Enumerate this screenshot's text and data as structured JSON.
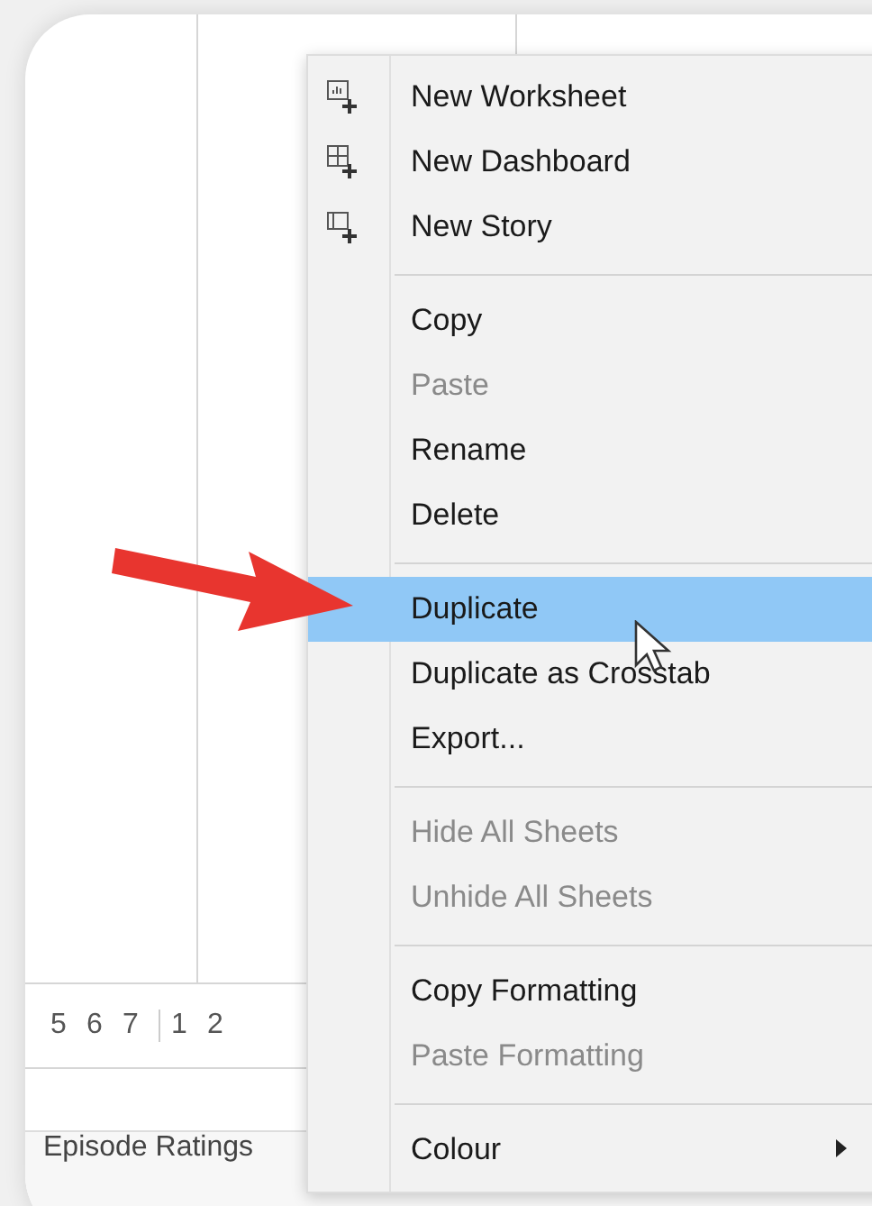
{
  "axis_labels": [
    "5",
    "6",
    "7",
    "1",
    "2"
  ],
  "sheet_tabs": [
    {
      "label": "Episode Ratings"
    }
  ],
  "context_menu": [
    {
      "kind": "create",
      "label": "New Worksheet",
      "disabled": false,
      "selected": false
    },
    {
      "kind": "create",
      "label": "New Dashboard",
      "disabled": false,
      "selected": false
    },
    {
      "kind": "create",
      "label": "New Story",
      "disabled": false,
      "selected": false
    },
    {
      "kind": "separator"
    },
    {
      "kind": "item",
      "label": "Copy",
      "disabled": false,
      "selected": false
    },
    {
      "kind": "item",
      "label": "Paste",
      "disabled": true,
      "selected": false
    },
    {
      "kind": "item",
      "label": "Rename",
      "disabled": false,
      "selected": false
    },
    {
      "kind": "item",
      "label": "Delete",
      "disabled": false,
      "selected": false
    },
    {
      "kind": "separator"
    },
    {
      "kind": "item",
      "label": "Duplicate",
      "disabled": false,
      "selected": true
    },
    {
      "kind": "item",
      "label": "Duplicate as Crosstab",
      "disabled": false,
      "selected": false
    },
    {
      "kind": "item",
      "label": "Export...",
      "disabled": false,
      "selected": false
    },
    {
      "kind": "separator"
    },
    {
      "kind": "item",
      "label": "Hide All Sheets",
      "disabled": true,
      "selected": false
    },
    {
      "kind": "item",
      "label": "Unhide All Sheets",
      "disabled": true,
      "selected": false
    },
    {
      "kind": "separator"
    },
    {
      "kind": "item",
      "label": "Copy Formatting",
      "disabled": false,
      "selected": false
    },
    {
      "kind": "item",
      "label": "Paste Formatting",
      "disabled": true,
      "selected": false
    },
    {
      "kind": "separator"
    },
    {
      "kind": "item",
      "label": "Colour",
      "disabled": false,
      "selected": false,
      "submenu": true
    }
  ]
}
